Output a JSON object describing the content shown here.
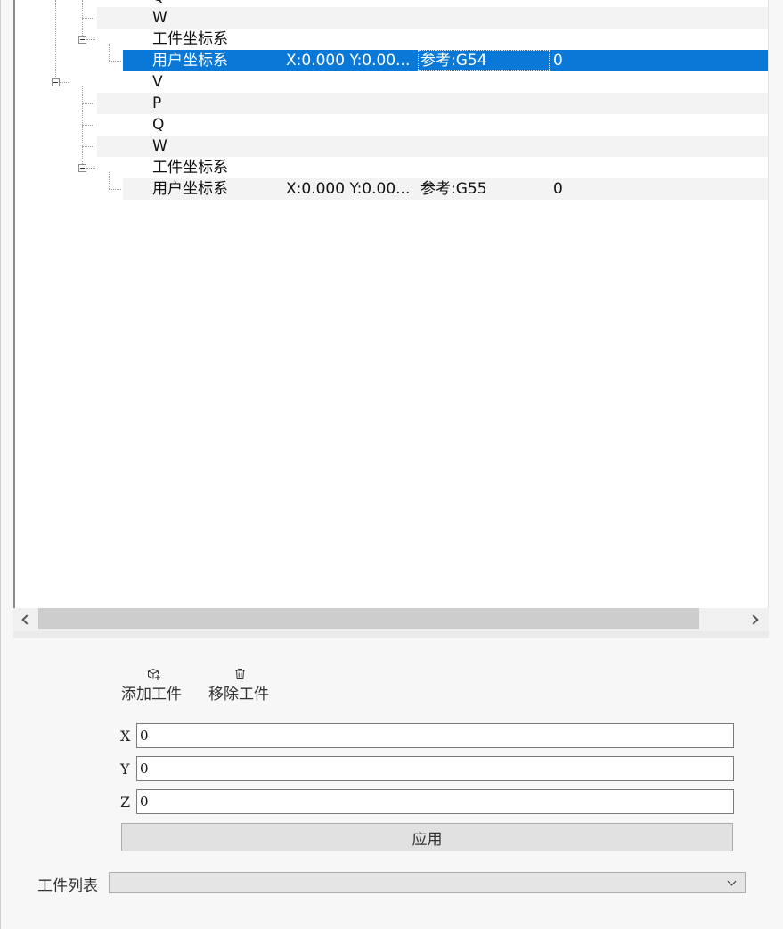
{
  "tree": {
    "rows": [
      {
        "label": "Q",
        "col2": "",
        "col3": "",
        "col4": ""
      },
      {
        "label": "W",
        "col2": "",
        "col3": "",
        "col4": ""
      },
      {
        "label": "工件坐标系",
        "col2": "",
        "col3": "",
        "col4": ""
      },
      {
        "label": "用户坐标系",
        "col2": "X:0.000 Y:0.00...",
        "col3": "参考:G54",
        "col4": "0",
        "selected": true
      },
      {
        "label": "V",
        "col2": "",
        "col3": "",
        "col4": ""
      },
      {
        "label": "P",
        "col2": "",
        "col3": "",
        "col4": ""
      },
      {
        "label": "Q",
        "col2": "",
        "col3": "",
        "col4": ""
      },
      {
        "label": "W",
        "col2": "",
        "col3": "",
        "col4": ""
      },
      {
        "label": "工件坐标系",
        "col2": "",
        "col3": "",
        "col4": ""
      },
      {
        "label": "用户坐标系",
        "col2": "X:0.000 Y:0.00...",
        "col3": "参考:G55",
        "col4": "0"
      }
    ]
  },
  "toolbar": {
    "add_label": "添加工件",
    "remove_label": "移除工件",
    "add_icon": "add-box-icon",
    "remove_icon": "trash-icon"
  },
  "coords": {
    "x_label": "X",
    "x_value": "0",
    "y_label": "Y",
    "y_value": "0",
    "z_label": "Z",
    "z_value": "0",
    "apply_label": "应用"
  },
  "workpiece_list": {
    "label": "工件列表",
    "selected": ""
  },
  "colors": {
    "selection": "#0a78d7",
    "alt_row": "#f3f3f3"
  }
}
